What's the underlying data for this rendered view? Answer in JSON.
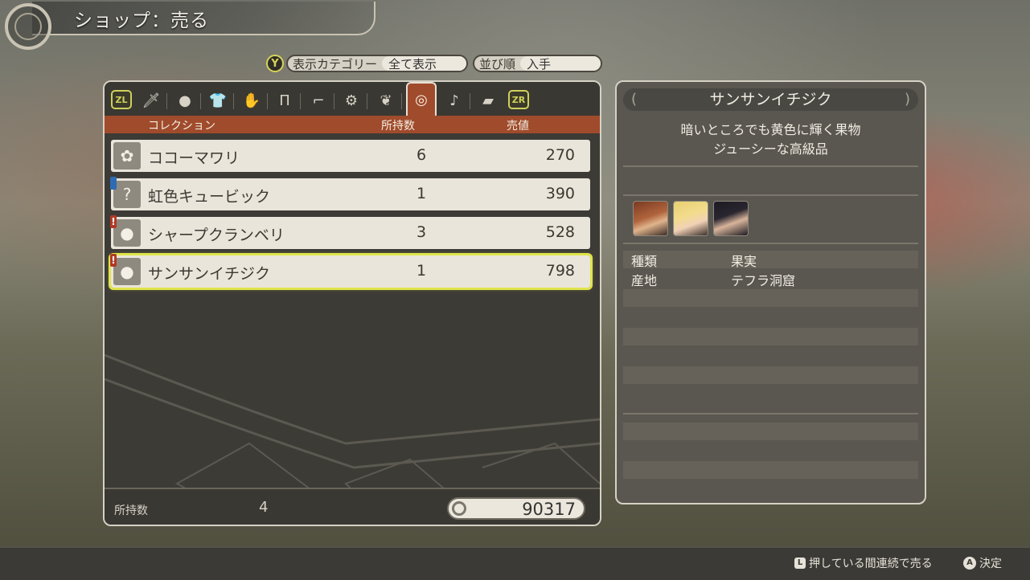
{
  "header": {
    "title": "ショップ：売る"
  },
  "filters": {
    "category_label": "表示カテゴリー",
    "category_value": "全て表示",
    "sort_label": "並び順",
    "sort_value": "入手",
    "y_button": "Y"
  },
  "tabs": {
    "left_shoulder": "ZL",
    "right_shoulder": "ZR",
    "icons": [
      "sword-icon",
      "head-icon",
      "shirt-icon",
      "arm-icon",
      "pants-icon",
      "boot-icon",
      "gear-icon",
      "plant-icon",
      "collection-icon",
      "music-note-icon",
      "book-icon"
    ],
    "active_index": 8
  },
  "list": {
    "columns": {
      "name": "コレクション",
      "qty": "所持数",
      "price": "売値"
    },
    "items": [
      {
        "name": "ココーマワリ",
        "qty": "6",
        "price": "270",
        "icon": "flower-icon",
        "mark": ""
      },
      {
        "name": "虹色キュービック",
        "qty": "1",
        "price": "390",
        "icon": "question-icon",
        "mark": "new"
      },
      {
        "name": "シャープクランベリ",
        "qty": "3",
        "price": "528",
        "icon": "fruit-icon",
        "mark": "!"
      },
      {
        "name": "サンサンイチジク",
        "qty": "1",
        "price": "798",
        "icon": "fruit-icon",
        "mark": "!"
      }
    ],
    "selected_index": 3
  },
  "footer": {
    "count_label": "所持数",
    "count_value": "4",
    "money": "90317"
  },
  "detail": {
    "title": "サンサンイチジク",
    "desc_line1": "暗いところでも黄色に輝く果物",
    "desc_line2": "ジューシーな高級品",
    "characters": [
      "character-1-portrait",
      "character-2-portrait",
      "character-3-portrait"
    ],
    "props": [
      {
        "label": "種類",
        "value": "果実"
      },
      {
        "label": "産地",
        "value": "テフラ洞窟"
      }
    ]
  },
  "hints": {
    "hold_key": "L",
    "hold_label": "押している間連続で売る",
    "confirm_key": "A",
    "confirm_label": "決定"
  },
  "colors": {
    "accent": "#a04b2c",
    "highlight": "#e0e44a",
    "panel": "#3d3b36"
  }
}
